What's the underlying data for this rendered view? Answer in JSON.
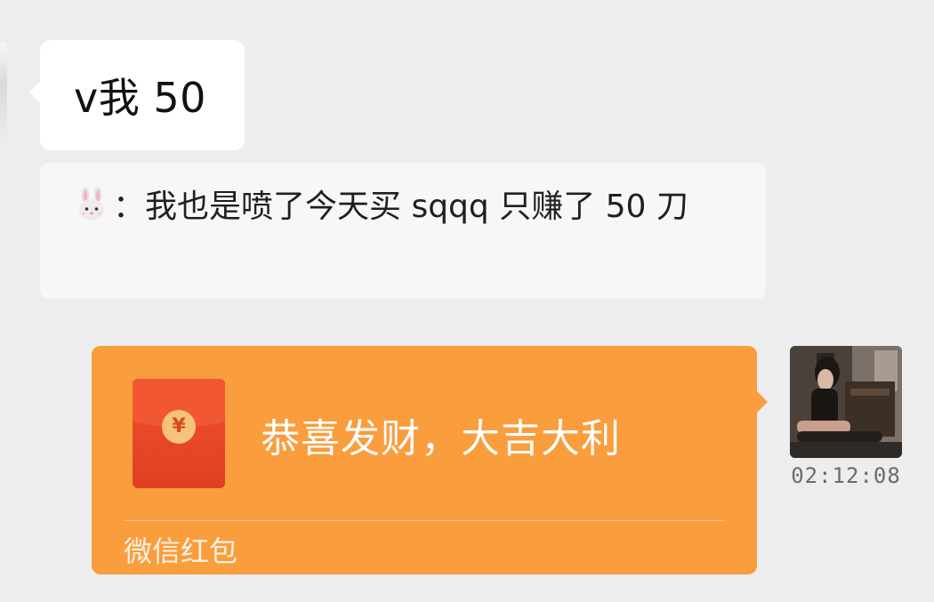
{
  "messages": {
    "incoming_text": "v我 50",
    "quote": {
      "emoji_icon": "rabbit-face-icon",
      "separator": "：",
      "text": "我也是喷了今天买 sqqq 只赚了 50 刀"
    },
    "red_packet": {
      "title": "恭喜发财，大吉大利",
      "footer": "微信红包",
      "envelope_icon": "red-envelope-icon",
      "currency_symbol": "¥",
      "accent_color": "#f99d3d",
      "envelope_color": "#e8472a"
    },
    "timestamp": "02:12:08"
  },
  "colors": {
    "background": "#ededed",
    "bubble_incoming": "#ffffff",
    "quote_background": "#f7f7f7",
    "timestamp_text": "#6b6b6b"
  }
}
